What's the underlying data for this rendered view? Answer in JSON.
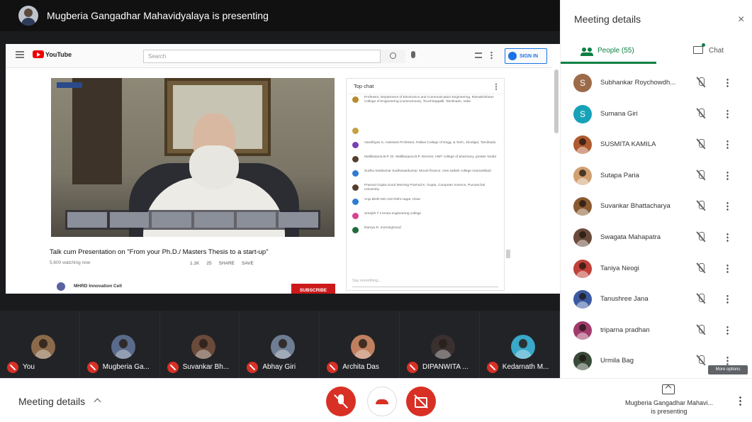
{
  "presenter": {
    "title": "Mugberia Gangadhar Mahavidyalaya is presenting"
  },
  "youtube": {
    "logo_text": "YouTube",
    "search_placeholder": "Search",
    "signin_label": "SIGN IN",
    "video_title": "Talk cum Presentation on \"From your Ph.D./ Masters Thesis to a start-up\"",
    "views": "5,600 watching now",
    "actions": [
      "1.1K",
      "25",
      "SHARE",
      "SAVE"
    ],
    "channel": "MHRD Innovation Cell",
    "subscribe_label": "SUBSCRIBE",
    "chat_header": "Top chat",
    "chat_placeholder": "Say something...",
    "chat_messages": [
      {
        "color": "#b68b2d",
        "text": "Professor, Department of Electronics and Communication Engineering, Ramakrishnan College of Engineering (Autonomous), Tiruchirappalli, Tamilnadu, India"
      },
      {
        "color": "#c8a040",
        "text": ""
      },
      {
        "color": "#7b3fb5",
        "text": "Vandhiyan S. Assistant Professor, Pallavi College of Engg. & Tech., Dindigul, Tamilnadu"
      },
      {
        "color": "#553e2a",
        "text": "Mallikarjuna B.P. Dr. Mallikarjuna B.P. Director, HMT college of pharmacy, greater Noida"
      },
      {
        "color": "#2e7bd3",
        "text": "Sudha Sasikumar Sudhasasikumar, Mount finance, mes saltaih college mannarkkad"
      },
      {
        "color": "#553e2a",
        "text": "Pramod Gupta Good Morning Pramod K. Gupta, Computer Science, Purvanchal University"
      },
      {
        "color": "#2e7bd3",
        "text": "Anju Bisht MG-119 Rishi nagar, Hisar"
      },
      {
        "color": "#d8428e",
        "text": "Sreejith T s kmea engineering college"
      },
      {
        "color": "#1f6b3a",
        "text": "Ramya R. morningGood"
      }
    ]
  },
  "strip": [
    {
      "name": "You",
      "color": "#8a6a4a"
    },
    {
      "name": "Mugberia Ga...",
      "color": "#5a6a8a"
    },
    {
      "name": "Suvankar Bh...",
      "color": "#6a4a3a"
    },
    {
      "name": "Abhay Giri",
      "color": "#6e7d92"
    },
    {
      "name": "Archita Das",
      "color": "#c08060"
    },
    {
      "name": "DIPANWITA ...",
      "color": "#3a3030"
    },
    {
      "name": "Kedarnath M...",
      "color": "#3aa8c8"
    }
  ],
  "bottom": {
    "meeting_details": "Meeting details",
    "presenting_name": "Mugberia Gangadhar Mahavi...",
    "presenting_state": "is presenting"
  },
  "panel": {
    "title": "Meeting details",
    "close_icon": "×",
    "people_tab": "People (55)",
    "chat_tab": "Chat",
    "tooltip": "More options",
    "people": [
      {
        "name": "Subhankar Roychowdh...",
        "initial": "S",
        "color": "#9c6b4a",
        "photo": false
      },
      {
        "name": "Sumana Giri",
        "initial": "S",
        "color": "#17a2b8",
        "photo": false
      },
      {
        "name": "SUSMITA KAMILA",
        "initial": "",
        "color": "#b05a30",
        "photo": true
      },
      {
        "name": "Sutapa Paria",
        "initial": "",
        "color": "#d0a070",
        "photo": true
      },
      {
        "name": "Suvankar Bhattacharya",
        "initial": "",
        "color": "#8a5a30",
        "photo": true
      },
      {
        "name": "Swagata Mahapatra",
        "initial": "",
        "color": "#6a4a3a",
        "photo": true
      },
      {
        "name": "Taniya Neogi",
        "initial": "",
        "color": "#c0403a",
        "photo": true
      },
      {
        "name": "Tanushree Jana",
        "initial": "",
        "color": "#3a5aa0",
        "photo": true
      },
      {
        "name": "triparna pradhan",
        "initial": "",
        "color": "#a03a6a",
        "photo": true
      },
      {
        "name": "Urmila Bag",
        "initial": "",
        "color": "#3a4a3a",
        "photo": true
      }
    ]
  }
}
